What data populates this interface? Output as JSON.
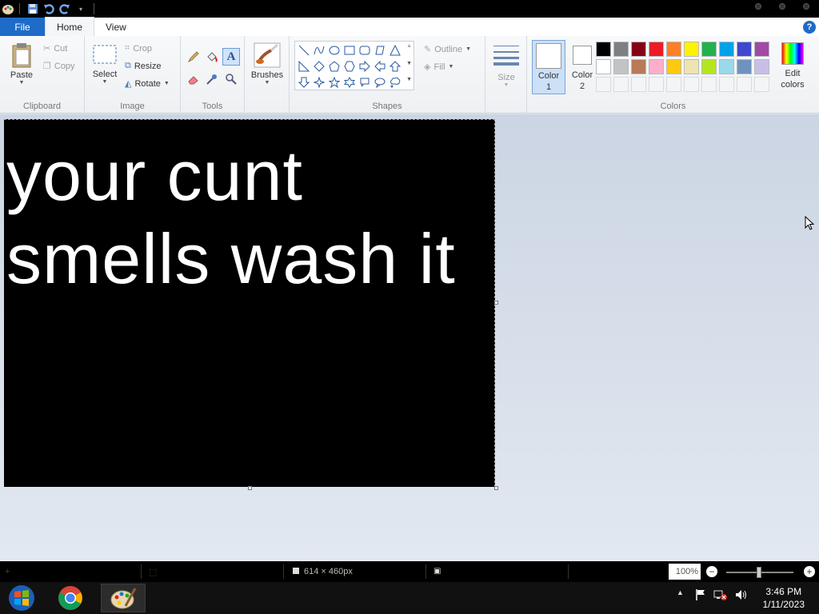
{
  "tabs": {
    "file": "File",
    "home": "Home",
    "view": "View"
  },
  "help": "?",
  "clipboard": {
    "label": "Clipboard",
    "paste": "Paste",
    "cut": "Cut",
    "copy": "Copy"
  },
  "image": {
    "label": "Image",
    "select": "Select",
    "crop": "Crop",
    "resize": "Resize",
    "rotate": "Rotate"
  },
  "tools": {
    "label": "Tools"
  },
  "brushes": {
    "label": "Brushes"
  },
  "shapes": {
    "label": "Shapes",
    "outline": "Outline",
    "fill": "Fill"
  },
  "size": {
    "label": "Size"
  },
  "colors": {
    "label": "Colors",
    "color1_label": "Color",
    "color1_num": "1",
    "color2_label": "Color",
    "color2_num": "2",
    "edit_label": "Edit",
    "edit_label2": "colors",
    "color1": "#ffffff",
    "color2": "#ffffff",
    "palette_row1": [
      "#000000",
      "#7f7f7f",
      "#880015",
      "#ed1c24",
      "#ff7f27",
      "#fff200",
      "#22b14c",
      "#00a2e8",
      "#3f48cc",
      "#a349a4"
    ],
    "palette_row2": [
      "#ffffff",
      "#c3c3c3",
      "#b97a57",
      "#ffaec9",
      "#ffc90e",
      "#efe4b0",
      "#b5e61d",
      "#99d9ea",
      "#7092be",
      "#c8bfe7"
    ]
  },
  "canvas": {
    "text_line1": "your cunt",
    "text_line2": "smells wash it",
    "background": "#000000",
    "text_color": "#ffffff"
  },
  "status": {
    "dimensions": "614 × 460px",
    "zoom": "100%",
    "zoom_level": 1.0
  },
  "taskbar": {
    "time": "3:46 PM",
    "date": "1/11/2023"
  }
}
